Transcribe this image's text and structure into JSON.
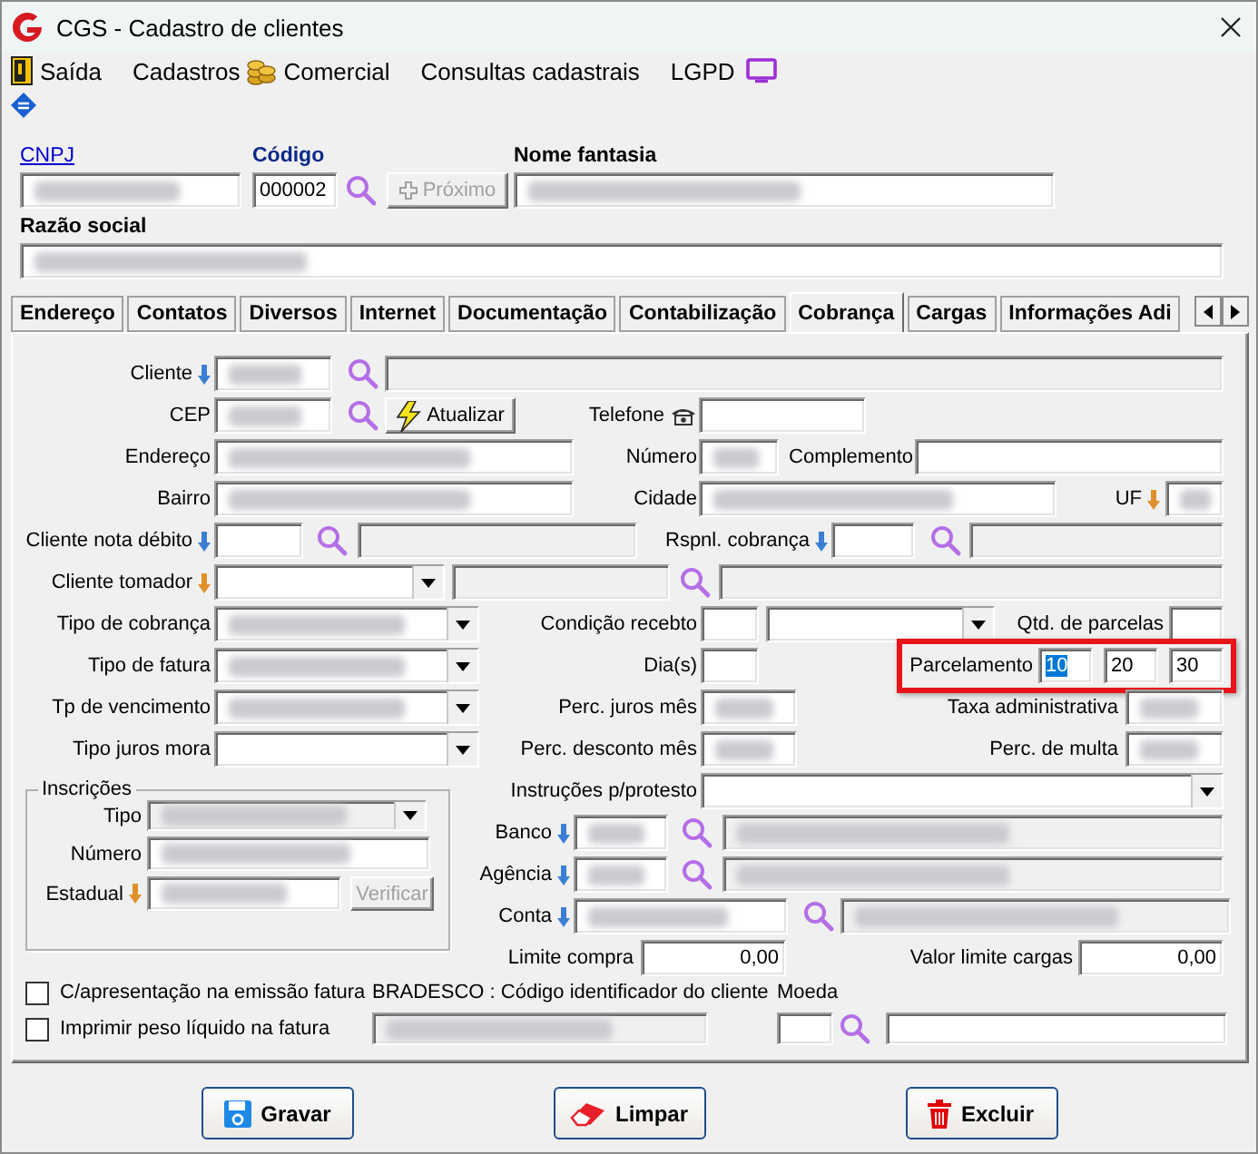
{
  "window": {
    "title": "CGS - Cadastro de clientes"
  },
  "menu": [
    {
      "kind": "exit",
      "label": "Saída"
    },
    {
      "kind": "plain",
      "label": "Cadastros"
    },
    {
      "kind": "coins",
      "label": "Comercial"
    },
    {
      "kind": "plain",
      "label": "Consultas cadastrais"
    },
    {
      "kind": "plain",
      "label": "LGPD"
    },
    {
      "kind": "monitor"
    }
  ],
  "header": {
    "cnpj": {
      "label": "CNPJ",
      "blurred": true,
      "disabled": false
    },
    "codigo": {
      "label": "Código",
      "value": "000002",
      "blurred": false,
      "disabled": false
    },
    "proximo": {
      "label": "Próximo",
      "disabled": true
    },
    "nome_fantasia": {
      "label": "Nome fantasia",
      "blurred": true,
      "disabled": false
    },
    "razao_social": {
      "label": "Razão social",
      "blurred": true,
      "disabled": false
    }
  },
  "tabs": [
    {
      "label": "Endereço",
      "selected": false
    },
    {
      "label": "Contatos",
      "selected": false
    },
    {
      "label": "Diversos",
      "selected": false
    },
    {
      "label": "Internet",
      "selected": false
    },
    {
      "label": "Documentação",
      "selected": false
    },
    {
      "label": "Contabilização",
      "selected": false
    },
    {
      "label": "Cobrança",
      "selected": true
    },
    {
      "label": "Cargas",
      "selected": false
    },
    {
      "label": "Informações Adi",
      "selected": false
    }
  ],
  "panel": {
    "top_rows": [
      [
        {
          "kind": "lookup_label",
          "text": "Cliente",
          "color": "#3b7fd4"
        },
        {
          "kind": "field",
          "blurred": true,
          "disabled": false
        },
        {
          "kind": "search"
        },
        {
          "kind": "field",
          "blurred": false,
          "disabled": true
        }
      ],
      [
        {
          "kind": "label",
          "text": "CEP"
        },
        {
          "kind": "field",
          "blurred": true,
          "disabled": false
        },
        {
          "kind": "search"
        },
        {
          "kind": "refresh_button",
          "text": "Atualizar",
          "disabled": false
        },
        {
          "kind": "phone_label",
          "text": "Telefone"
        },
        {
          "kind": "field",
          "blurred": false,
          "disabled": false
        }
      ],
      [
        {
          "kind": "label",
          "text": "Endereço"
        },
        {
          "kind": "field",
          "blurred": true,
          "disabled": false
        },
        {
          "kind": "label",
          "text": "Número"
        },
        {
          "kind": "field",
          "blurred": true,
          "disabled": false
        },
        {
          "kind": "label",
          "text": "Complemento"
        },
        {
          "kind": "field",
          "blurred": false,
          "disabled": false
        }
      ],
      [
        {
          "kind": "label",
          "text": "Bairro"
        },
        {
          "kind": "field",
          "blurred": true,
          "disabled": false
        },
        {
          "kind": "label",
          "text": "Cidade"
        },
        {
          "kind": "field",
          "blurred": true,
          "disabled": false
        },
        {
          "kind": "lookup_label",
          "text": "UF",
          "color": "#e0902a"
        },
        {
          "kind": "field",
          "blurred": true,
          "disabled": false
        }
      ],
      [
        {
          "kind": "lookup_label",
          "text": "Cliente nota débito",
          "color": "#3b7fd4"
        },
        {
          "kind": "field",
          "blurred": false,
          "disabled": false
        },
        {
          "kind": "search"
        },
        {
          "kind": "field",
          "blurred": false,
          "disabled": true
        },
        {
          "kind": "lookup_label",
          "text": "Rspnl. cobrança",
          "color": "#3b7fd4"
        },
        {
          "kind": "field",
          "blurred": false,
          "disabled": false
        },
        {
          "kind": "search"
        },
        {
          "kind": "field",
          "blurred": false,
          "disabled": true
        }
      ],
      [
        {
          "kind": "lookup_label",
          "text": "Cliente tomador",
          "color": "#e0902a"
        },
        {
          "kind": "combo",
          "blurred": false,
          "disabled": false
        },
        {
          "kind": "field",
          "blurred": false,
          "disabled": true
        },
        {
          "kind": "search"
        },
        {
          "kind": "field",
          "blurred": false,
          "disabled": true
        }
      ],
      [
        {
          "kind": "label",
          "text": "Tipo de cobrança"
        },
        {
          "kind": "combo",
          "blurred": true,
          "disabled": false
        },
        {
          "kind": "label",
          "text": "Condição recebto"
        },
        {
          "kind": "field",
          "blurred": false,
          "disabled": false
        },
        {
          "kind": "combo",
          "blurred": false,
          "disabled": false
        },
        {
          "kind": "label",
          "text": "Qtd. de parcelas"
        },
        {
          "kind": "field",
          "blurred": false,
          "disabled": false
        }
      ],
      [
        {
          "kind": "label",
          "text": "Tipo de fatura"
        },
        {
          "kind": "combo",
          "blurred": true,
          "disabled": false
        },
        {
          "kind": "label",
          "text": "Dia(s)"
        },
        {
          "kind": "field",
          "blurred": false,
          "disabled": false
        },
        {
          "kind": "highlight",
          "items": [
            {
              "kind": "label",
              "text": "Parcelamento"
            },
            {
              "kind": "field",
              "value": "10",
              "value_selected": true,
              "blurred": false,
              "disabled": false
            },
            {
              "kind": "field",
              "value": "20",
              "value_selected": false,
              "blurred": false,
              "disabled": false
            },
            {
              "kind": "field",
              "value": "30",
              "value_selected": false,
              "blurred": false,
              "disabled": false
            }
          ]
        }
      ],
      [
        {
          "kind": "label",
          "text": "Tp de vencimento"
        },
        {
          "kind": "combo",
          "blurred": true,
          "disabled": false
        },
        {
          "kind": "label",
          "text": "Perc. juros mês"
        },
        {
          "kind": "field",
          "blurred": true,
          "disabled": false
        },
        {
          "kind": "label",
          "text": "Taxa administrativa"
        },
        {
          "kind": "field",
          "blurred": true,
          "disabled": false
        }
      ],
      [
        {
          "kind": "label",
          "text": "Tipo juros mora"
        },
        {
          "kind": "combo",
          "blurred": false,
          "disabled": false
        },
        {
          "kind": "label",
          "text": "Perc. desconto mês"
        },
        {
          "kind": "field",
          "blurred": true,
          "disabled": false
        },
        {
          "kind": "label",
          "text": "Perc. de multa"
        },
        {
          "kind": "field",
          "blurred": true,
          "disabled": false
        }
      ]
    ],
    "inscricoes": {
      "title": "Inscrições",
      "rows": [
        [
          {
            "kind": "label",
            "text": "Tipo"
          },
          {
            "kind": "combo",
            "blurred": true,
            "disabled": true
          }
        ],
        [
          {
            "kind": "label",
            "text": "Número"
          },
          {
            "kind": "field",
            "blurred": true,
            "disabled": false
          }
        ],
        [
          {
            "kind": "lookup_label",
            "text": "Estadual",
            "color": "#e0902a"
          },
          {
            "kind": "field",
            "blurred": true,
            "disabled": false
          },
          {
            "kind": "button",
            "text": "Verificar",
            "disabled": true
          }
        ]
      ]
    },
    "right_rows": [
      [
        {
          "kind": "label",
          "text": "Instruções p/protesto"
        },
        {
          "kind": "combo",
          "blurred": false,
          "disabled": false
        }
      ],
      [
        {
          "kind": "lookup_label",
          "text": "Banco",
          "color": "#3b7fd4"
        },
        {
          "kind": "field",
          "blurred": true,
          "disabled": false
        },
        {
          "kind": "search"
        },
        {
          "kind": "field",
          "blurred": true,
          "disabled": true
        }
      ],
      [
        {
          "kind": "lookup_label",
          "text": "Agência",
          "color": "#3b7fd4"
        },
        {
          "kind": "field",
          "blurred": true,
          "disabled": false
        },
        {
          "kind": "search"
        },
        {
          "kind": "field",
          "blurred": true,
          "disabled": true
        }
      ],
      [
        {
          "kind": "lookup_label",
          "text": "Conta",
          "color": "#3b7fd4"
        },
        {
          "kind": "field",
          "blurred": true,
          "disabled": false
        },
        {
          "kind": "search"
        },
        {
          "kind": "field",
          "blurred": true,
          "disabled": true
        }
      ],
      [
        {
          "kind": "label",
          "text": "Limite compra"
        },
        {
          "kind": "number",
          "value": "0,00",
          "blurred": false,
          "disabled": false
        },
        {
          "kind": "label",
          "text": "Valor limite cargas"
        },
        {
          "kind": "number",
          "value": "0,00",
          "blurred": false,
          "disabled": false
        }
      ]
    ],
    "bottom_rows": [
      [
        {
          "kind": "checkbox",
          "text": "C/apresentação na emissão fatura",
          "checked": false
        },
        {
          "kind": "label",
          "text": "BRADESCO : Código identificador do cliente"
        },
        {
          "kind": "label",
          "text": "Moeda"
        }
      ],
      [
        {
          "kind": "checkbox",
          "text": "Imprimir peso líquido na fatura",
          "checked": false
        },
        {
          "kind": "field",
          "blurred": true,
          "disabled": true
        },
        {
          "kind": "field",
          "blurred": false,
          "disabled": false
        },
        {
          "kind": "search"
        },
        {
          "kind": "field",
          "blurred": false,
          "disabled": false
        }
      ]
    ]
  },
  "buttons": [
    {
      "kind": "save",
      "label": "Gravar"
    },
    {
      "kind": "clear",
      "label": "Limpar"
    },
    {
      "kind": "delete",
      "label": "Excluir"
    }
  ]
}
